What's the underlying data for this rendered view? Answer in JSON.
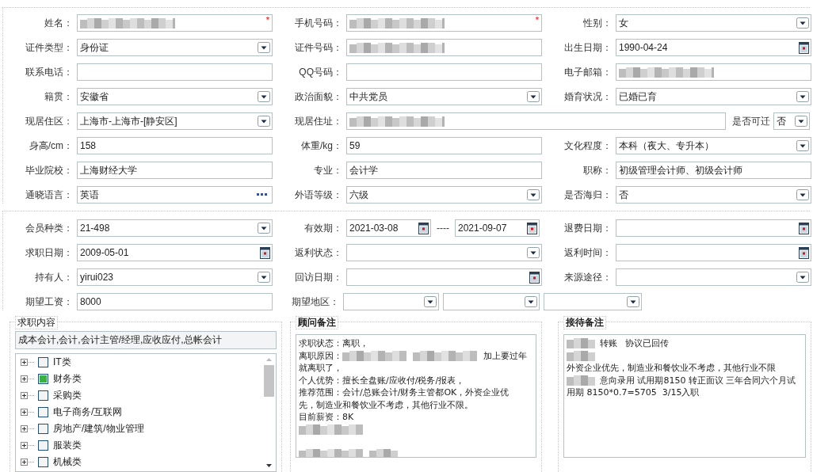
{
  "personal": {
    "rows": [
      [
        {
          "label": "姓名：",
          "kind": "text",
          "redacted": true,
          "required_mark": "*"
        },
        {
          "label": "手机号码：",
          "kind": "text",
          "redacted": true,
          "required_mark": "*"
        },
        {
          "label": "性别：",
          "kind": "select",
          "value": "女"
        }
      ],
      [
        {
          "label": "证件类型：",
          "kind": "select",
          "value": "身份证"
        },
        {
          "label": "证件号码：",
          "kind": "text",
          "redacted": true
        },
        {
          "label": "出生日期：",
          "kind": "date",
          "value": "1990-04-24"
        }
      ],
      [
        {
          "label": "联系电话：",
          "kind": "text"
        },
        {
          "label": "QQ号码：",
          "kind": "text"
        },
        {
          "label": "电子邮箱：",
          "kind": "text",
          "redacted": true
        }
      ],
      [
        {
          "label": "籍贯：",
          "kind": "select",
          "value": "安徽省"
        },
        {
          "label": "政治面貌：",
          "kind": "select",
          "value": "中共党员"
        },
        {
          "label": "婚育状况：",
          "kind": "select",
          "value": "已婚已育"
        }
      ],
      [
        {
          "label": "现居住区：",
          "kind": "select",
          "value": "上海市-上海市-[静安区]"
        },
        {
          "label": "现居住址：",
          "kind": "text",
          "redacted": true
        },
        {
          "label": "是否可迁",
          "kind": "mini-select",
          "value": "否"
        }
      ],
      [
        {
          "label": "身高/cm：",
          "kind": "text",
          "value": "158"
        },
        {
          "label": "体重/kg：",
          "kind": "text",
          "value": "59"
        },
        {
          "label": "文化程度：",
          "kind": "select",
          "value": "本科（夜大、专升本）"
        }
      ],
      [
        {
          "label": "毕业院校：",
          "kind": "text",
          "value": "上海财经大学"
        },
        {
          "label": "专业：",
          "kind": "text",
          "value": "会计学"
        },
        {
          "label": "职称：",
          "kind": "text",
          "value": "初级管理会计师、初级会计师"
        }
      ],
      [
        {
          "label": "通晓语言：",
          "kind": "lookup",
          "value": "英语"
        },
        {
          "label": "外语等级：",
          "kind": "select",
          "value": "六级"
        },
        {
          "label": "是否海归：",
          "kind": "select",
          "value": "否"
        }
      ]
    ]
  },
  "membership": {
    "rows": [
      [
        {
          "label": "会员种类：",
          "kind": "select",
          "value": "21-498"
        },
        {
          "label": "有效期：",
          "kind": "date-range",
          "value": "2021-03-08",
          "end_value": "2021-09-07",
          "separator": "----"
        },
        {
          "label": "退费日期：",
          "kind": "date"
        }
      ],
      [
        {
          "label": "求职日期：",
          "kind": "date",
          "value": "2009-05-01"
        },
        {
          "label": "返利状态：",
          "kind": "select"
        },
        {
          "label": "返利时间：",
          "kind": "date"
        }
      ],
      [
        {
          "label": "持有人：",
          "kind": "select",
          "value": "yirui023"
        },
        {
          "label": "回访日期：",
          "kind": "date"
        },
        {
          "label": "来源途径：",
          "kind": "select"
        }
      ],
      [
        {
          "label": "期望工资：",
          "kind": "text",
          "value": "8000"
        },
        {
          "label": "期望地区：",
          "kind": "select-trio"
        }
      ]
    ]
  },
  "job_intent": {
    "legend": "求职内容",
    "bold": false,
    "summary": "成本会计,会计,会计主管/经理,应收应付,总帐会计",
    "categories": [
      {
        "label": "IT类",
        "expanded": false,
        "checked": false
      },
      {
        "label": "财务类",
        "expanded": false,
        "checked": true
      },
      {
        "label": "采购类",
        "expanded": false,
        "checked": false
      },
      {
        "label": "电子商务/互联网",
        "expanded": false,
        "checked": false
      },
      {
        "label": "房地产/建筑/物业管理",
        "expanded": false,
        "checked": false
      },
      {
        "label": "服装类",
        "expanded": false,
        "checked": false
      },
      {
        "label": "机械类",
        "expanded": false,
        "checked": false
      }
    ]
  },
  "consultant_notes": {
    "legend": "顾问备注",
    "bold": true,
    "lines": [
      [
        {
          "kind": "text",
          "text": "求职状态：离职，"
        }
      ],
      [
        {
          "kind": "text",
          "text": "离职原因："
        },
        {
          "kind": "blur"
        },
        {
          "kind": "blur"
        },
        {
          "kind": "text",
          "text": "加上要过年"
        }
      ],
      [
        {
          "kind": "text",
          "text": "就离职了，"
        }
      ],
      [
        {
          "kind": "text",
          "text": "个人优势：擅长全盘账/应收付/税务/报表，"
        }
      ],
      [
        {
          "kind": "text",
          "text": "推荐范围：会计/总账会计/财务主管都OK，外资企业优"
        }
      ],
      [
        {
          "kind": "text",
          "text": "先，制造业和餐饮业不考虑，其他行业不限。"
        }
      ],
      [
        {
          "kind": "text",
          "text": "目前薪资：8K"
        }
      ],
      [
        {
          "kind": "blur"
        }
      ],
      [
        {
          "kind": "gap"
        }
      ],
      [
        {
          "kind": "blur"
        },
        {
          "kind": "blur-short"
        }
      ]
    ]
  },
  "reception_notes": {
    "legend": "接待备注",
    "bold": true,
    "lines": [
      [
        {
          "kind": "blur-short"
        },
        {
          "kind": "text",
          "text": "转账   协议已回传"
        }
      ],
      [
        {
          "kind": "blur-short"
        }
      ],
      [
        {
          "kind": "text",
          "text": "外资企业优先，制造业和餐饮业不考虑，其他行业不限"
        }
      ],
      [
        {
          "kind": "blur-short"
        },
        {
          "kind": "text",
          "text": "意向录用 试用期8150 转正面议 三年合同六个月试"
        }
      ],
      [
        {
          "kind": "text",
          "text": "用期 8150*0.7=5705  3/15入职"
        }
      ]
    ]
  }
}
